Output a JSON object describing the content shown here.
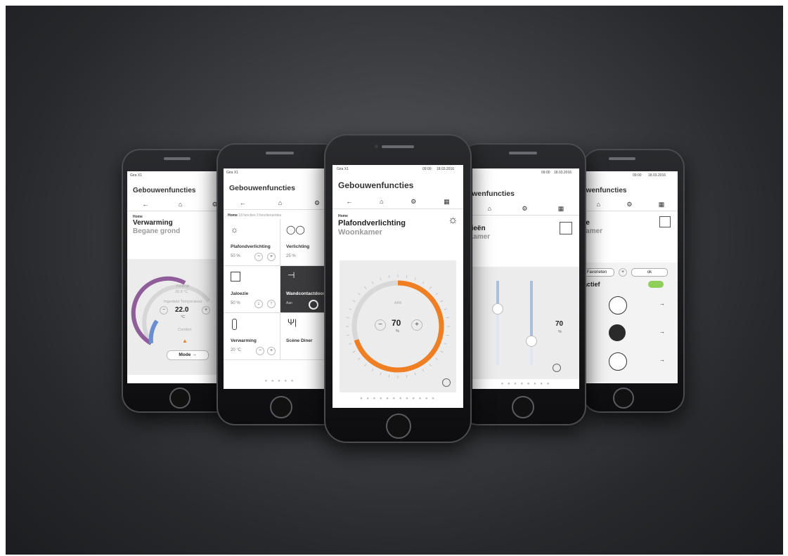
{
  "left_phone": {
    "carrier": "Gira X1",
    "title": "Gebouwenfuncties",
    "crumb": "Home",
    "device": "Verwarming",
    "room": "Begane grond",
    "comfort": "Comfort",
    "mode": "Mode",
    "setpoint_label": "Ingesteld Temperatuur",
    "setpoint_value": "22.0",
    "unit": "°C",
    "current_label": "Feitelijk",
    "current_value": "20.5 °C",
    "setpoint_level": 0.55
  },
  "second_phone": {
    "carrier": "Gira X1",
    "title": "Gebouwenfuncties",
    "crumb": "Home",
    "crumb_detail": "18 functies 3 functieruimtes",
    "tiles": [
      {
        "name": "Plafondverlichting",
        "value": "50 %",
        "icon": "bulb-icon"
      },
      {
        "name": "Verlichting",
        "value": "25 %",
        "icon": "lamps-icon"
      },
      {
        "name": "Jaloezie",
        "value": "50 %",
        "icon": "blind-icon"
      },
      {
        "name": "Wandcontactdoos",
        "value": "Aan",
        "icon": "socket-icon"
      },
      {
        "name": "Verwarming",
        "value": "20 °C",
        "icon": "thermometer-icon"
      },
      {
        "name": "Scène Diner",
        "value": "",
        "icon": "cutlery-icon"
      }
    ]
  },
  "center_phone": {
    "carrier": "Gira X1",
    "time": "09:00",
    "date": "18.03.2016",
    "title": "Gebouwenfuncties",
    "crumb": "Home",
    "device": "Plafondverlichting",
    "room": "Woonkamer",
    "switch_label": "AAN",
    "value": "70",
    "unit": "%",
    "dim_level": 0.7,
    "minus": "−",
    "plus": "+"
  },
  "fourth_phone": {
    "title": "Gebouwenfuncties",
    "device": "Jaloezieën",
    "room": "Woonkamer",
    "value": "70",
    "unit": "%",
    "time": "09:00",
    "date": "18.03.2016"
  },
  "right_phone": {
    "title": "Gebouwenfuncties",
    "device": "Jaloezie",
    "room": "Woonkamer",
    "prev_btn": "Favorieten",
    "ok_btn": "ok",
    "active_label": "actief",
    "time": "09:00",
    "date": "18.03.2016"
  },
  "colors": {
    "accent_orange": "#f07f24",
    "heating_purple": "#8f5d9a",
    "blind_blue": "#a9bfe0",
    "toggle_green": "#8fcf5a"
  }
}
